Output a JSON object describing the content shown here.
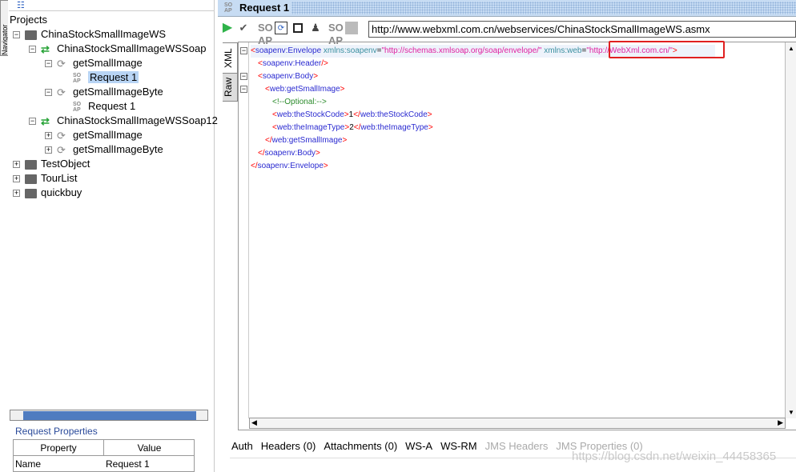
{
  "navigator": {
    "tab_label": "Navigator"
  },
  "tree": {
    "root": "Projects",
    "nodes": [
      {
        "label": "ChinaStockSmallImageWS",
        "type": "project",
        "expanded": true,
        "depth": 0
      },
      {
        "label": "ChinaStockSmallImageWSSoap",
        "type": "interface",
        "expanded": true,
        "depth": 1
      },
      {
        "label": "getSmallImage",
        "type": "operation",
        "expanded": true,
        "depth": 2
      },
      {
        "label": "Request 1",
        "type": "request",
        "depth": 3,
        "selected": true
      },
      {
        "label": "getSmallImageByte",
        "type": "operation",
        "expanded": true,
        "depth": 2
      },
      {
        "label": "Request 1",
        "type": "request",
        "depth": 3
      },
      {
        "label": "ChinaStockSmallImageWSSoap12",
        "type": "interface",
        "expanded": true,
        "depth": 1
      },
      {
        "label": "getSmallImage",
        "type": "operation",
        "expanded": false,
        "depth": 2
      },
      {
        "label": "getSmallImageByte",
        "type": "operation",
        "expanded": false,
        "depth": 2
      },
      {
        "label": "TestObject",
        "type": "project",
        "expanded": false,
        "depth": 0
      },
      {
        "label": "TourList",
        "type": "project",
        "expanded": false,
        "depth": 0
      },
      {
        "label": "quickbuy",
        "type": "project",
        "expanded": false,
        "depth": 0
      }
    ]
  },
  "request_properties": {
    "title": "Request Properties",
    "headers": [
      "Property",
      "Value"
    ],
    "rows": [
      [
        "Name",
        "Request 1"
      ]
    ]
  },
  "editor": {
    "title": "Request 1",
    "soap_badge": "SO AP",
    "url": "http://www.webxml.com.cn/webservices/ChinaStockSmallImageWS.asmx",
    "side_tabs": [
      "XML",
      "Raw"
    ],
    "lines": [
      {
        "fold": true,
        "indent": 0,
        "tokens": [
          [
            "br",
            "<"
          ],
          [
            "tag",
            "soapenv:Envelope"
          ],
          [
            "attr",
            " xmlns:soapenv"
          ],
          [
            "txt",
            "="
          ],
          [
            "val",
            "\"http://schemas.xmlsoap.org/soap/envelope/\""
          ],
          [
            "attr",
            " xmlns:web"
          ],
          [
            "txt",
            "="
          ],
          [
            "val",
            "\"http://WebXml.com.cn/\""
          ],
          [
            "br",
            ">"
          ]
        ]
      },
      {
        "fold": false,
        "indent": 1,
        "tokens": [
          [
            "br",
            "<"
          ],
          [
            "tag",
            "soapenv:Header"
          ],
          [
            "br",
            "/>"
          ]
        ]
      },
      {
        "fold": true,
        "indent": 1,
        "tokens": [
          [
            "br",
            "<"
          ],
          [
            "tag",
            "soapenv:Body"
          ],
          [
            "br",
            ">"
          ]
        ]
      },
      {
        "fold": true,
        "indent": 2,
        "tokens": [
          [
            "br",
            "<"
          ],
          [
            "tag",
            "web:getSmallImage"
          ],
          [
            "br",
            ">"
          ]
        ]
      },
      {
        "fold": false,
        "indent": 3,
        "tokens": [
          [
            "cmt",
            "<!--Optional:-->"
          ]
        ]
      },
      {
        "fold": false,
        "indent": 3,
        "tokens": [
          [
            "br",
            "<"
          ],
          [
            "tag",
            "web:theStockCode"
          ],
          [
            "br",
            ">"
          ],
          [
            "txt",
            "1"
          ],
          [
            "br",
            "</"
          ],
          [
            "tag",
            "web:theStockCode"
          ],
          [
            "br",
            ">"
          ]
        ]
      },
      {
        "fold": false,
        "indent": 3,
        "tokens": [
          [
            "br",
            "<"
          ],
          [
            "tag",
            "web:theImageType"
          ],
          [
            "br",
            ">"
          ],
          [
            "txt",
            "2"
          ],
          [
            "br",
            "</"
          ],
          [
            "tag",
            "web:theImageType"
          ],
          [
            "br",
            ">"
          ]
        ]
      },
      {
        "fold": false,
        "indent": 2,
        "tokens": [
          [
            "br",
            "</"
          ],
          [
            "tag",
            "web:getSmallImage"
          ],
          [
            "br",
            ">"
          ]
        ]
      },
      {
        "fold": false,
        "indent": 1,
        "tokens": [
          [
            "br",
            "</"
          ],
          [
            "tag",
            "soapenv:Body"
          ],
          [
            "br",
            ">"
          ]
        ]
      },
      {
        "fold": false,
        "indent": 0,
        "tokens": [
          [
            "br",
            "</"
          ],
          [
            "tag",
            "soapenv:Envelope"
          ],
          [
            "br",
            ">"
          ]
        ]
      }
    ]
  },
  "bottom_tabs": [
    {
      "label": "Auth",
      "enabled": true
    },
    {
      "label": "Headers (0)",
      "enabled": true
    },
    {
      "label": "Attachments (0)",
      "enabled": true
    },
    {
      "label": "WS-A",
      "enabled": true
    },
    {
      "label": "WS-RM",
      "enabled": true
    },
    {
      "label": "JMS Headers",
      "enabled": false
    },
    {
      "label": "JMS Properties (0)",
      "enabled": false
    }
  ],
  "watermark": "https://blog.csdn.net/weixin_44458365",
  "colors": {
    "highlight_box": "#e02020",
    "selection": "#b8d4f4",
    "title_bar": "#c7dcf3"
  }
}
